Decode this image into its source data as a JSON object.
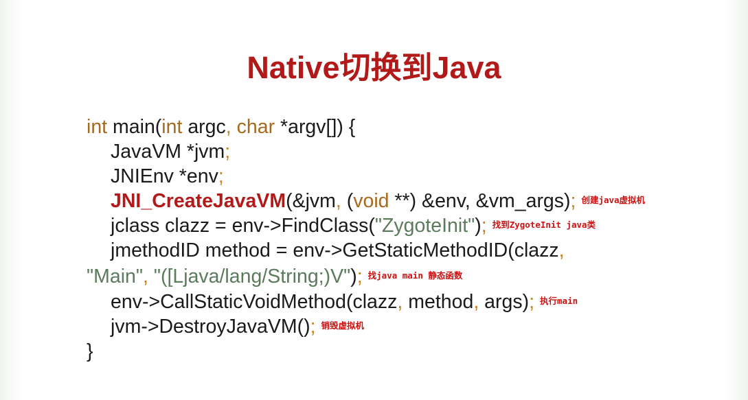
{
  "slide": {
    "title": "Native切换到Java"
  },
  "code": {
    "l1": {
      "kw_int1": "int",
      "t1": " main(",
      "kw_int2": "int",
      "t2": " argc",
      "comma": ",",
      "sp": " ",
      "kw_char": "char",
      "t3": " *argv[]) {"
    },
    "l2": {
      "t": "JavaVM *jvm",
      "semi": ";"
    },
    "l3": {
      "t": "JNIEnv *env",
      "semi": ";"
    },
    "l4": {
      "fn": "JNI_CreateJavaVM",
      "t1": "(&jvm",
      "comma": ",",
      "t2": " (",
      "kw_void": "void",
      "t3": " **) &env, &vm_args)",
      "semi": ";",
      "note": "创建java虚拟机"
    },
    "l5": {
      "t1": "jclass clazz = env->FindClass(",
      "str": "\"ZygoteInit\"",
      "t2": ")",
      "semi": ";",
      "note": "找到ZygoteInit  java类"
    },
    "l6": {
      "t1": "jmethodID method = env->GetStaticMethodID(clazz",
      "comma": ","
    },
    "l7": {
      "str1": "\"Main\"",
      "comma": ",",
      "sp": " ",
      "str2": "\"([Ljava/lang/String;)V\"",
      "t1": ")",
      "semi": ";",
      "note": "找java main 静态函数"
    },
    "l8": {
      "t1": "env->CallStaticVoidMethod(clazz",
      "comma1": ",",
      "t2": " method",
      "comma2": ",",
      "t3": " args)",
      "semi": ";",
      "note": "执行main"
    },
    "l9": {
      "t1": "jvm->DestroyJavaVM()",
      "semi": ";",
      "note": "销毁虚拟机"
    },
    "l10": {
      "t": "}"
    }
  },
  "colors": {
    "title": "#b21a1a",
    "keyword": "#a36a20",
    "punctuation": "#c6821e",
    "string": "#5a7c5a",
    "note": "#cc1111",
    "text": "#1a1a1a"
  }
}
